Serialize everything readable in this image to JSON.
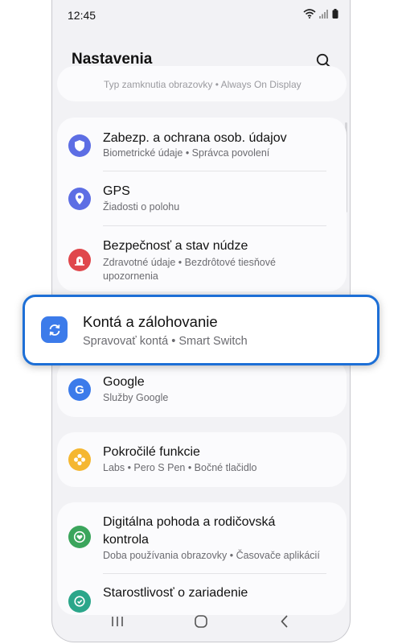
{
  "status_bar": {
    "time": "12:45"
  },
  "header": {
    "title": "Nastavenia"
  },
  "peek_item": {
    "subtitle": "Typ zamknutia obrazovky  •  Always On Display"
  },
  "items": [
    {
      "title": "Zabezp. a ochrana osob. údajov",
      "subtitle": "Biometrické údaje  •  Správca povolení",
      "icon": "shield-icon",
      "color": "#5d6ee4"
    },
    {
      "title": "GPS",
      "subtitle": "Žiadosti o polohu",
      "icon": "location-pin-icon",
      "color": "#5d6ee4"
    },
    {
      "title": "Bezpečnosť a stav núdze",
      "subtitle": "Zdravotné údaje  •  Bezdrôtové tiesňové upozornenia",
      "icon": "emergency-icon",
      "color": "#e0474c"
    },
    {
      "title": "Kontá a zálohovanie",
      "subtitle": "Spravovať kontá  •  Smart Switch",
      "icon": "sync-icon",
      "color": "#3c7bea"
    },
    {
      "title": "Google",
      "subtitle": "Služby Google",
      "icon": "google-icon",
      "color": "#3c7bea"
    },
    {
      "title": "Pokročilé funkcie",
      "subtitle": "Labs  •  Pero S Pen  •  Bočné tlačidlo",
      "icon": "gear-flower-icon",
      "color": "#f5b731"
    },
    {
      "title": "Digitálna pohoda a rodičovská kontrola",
      "subtitle": "Doba používania obrazovky  •  Časovače aplikácií",
      "icon": "heart-icon",
      "color": "#3ba55c"
    },
    {
      "title": "Starostlivosť o zariadenie",
      "subtitle": "",
      "icon": "device-care-icon",
      "color": "#2ba68a"
    }
  ],
  "highlight_color": "#1d6fd6"
}
